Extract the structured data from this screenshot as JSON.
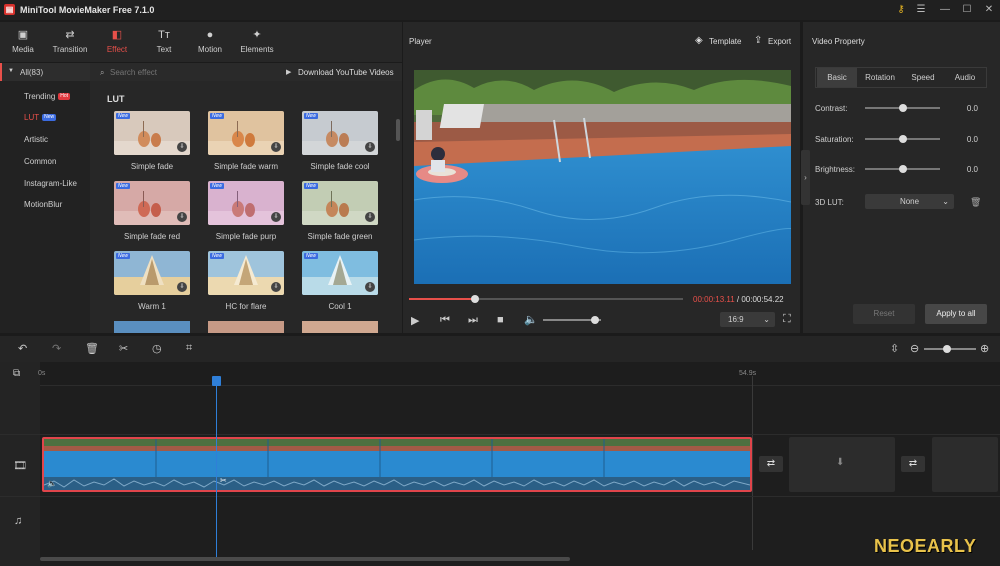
{
  "app": {
    "title": "MiniTool MovieMaker Free 7.1.0"
  },
  "toolbar": [
    {
      "label": "Media",
      "icon": "media-icon",
      "glyph": "▣"
    },
    {
      "label": "Transition",
      "icon": "transition-icon",
      "glyph": "⇄"
    },
    {
      "label": "Effect",
      "icon": "effect-icon",
      "glyph": "◧"
    },
    {
      "label": "Text",
      "icon": "text-icon",
      "glyph": "Tт"
    },
    {
      "label": "Motion",
      "icon": "motion-icon",
      "glyph": "●"
    },
    {
      "label": "Elements",
      "icon": "elements-icon",
      "glyph": "✦"
    }
  ],
  "active_tool": "Effect",
  "sidebar": {
    "all_label": "All(83)",
    "items": [
      {
        "label": "Trending",
        "badge": "Hot",
        "badge_color": "#e0383e"
      },
      {
        "label": "LUT",
        "badge": "New",
        "badge_color": "#3b6be0",
        "active": true
      },
      {
        "label": "Artistic",
        "badge": ""
      },
      {
        "label": "Common",
        "badge": ""
      },
      {
        "label": "Instagram-Like",
        "badge": ""
      },
      {
        "label": "MotionBlur",
        "badge": ""
      }
    ]
  },
  "effects": {
    "search_placeholder": "Search effect",
    "download_link": "Download YouTube Videos",
    "section_title": "LUT",
    "new_badge": "New",
    "items": [
      {
        "label": "Simple fade",
        "tint": "#d8c9bc"
      },
      {
        "label": "Simple fade warm",
        "tint": "#e0c39f"
      },
      {
        "label": "Simple fade cool",
        "tint": "#c6cbd0"
      },
      {
        "label": "Simple fade red",
        "tint": "#d6a9a6"
      },
      {
        "label": "Simple fade purp",
        "tint": "#d9b2cf"
      },
      {
        "label": "Simple fade green",
        "tint": "#c2cdb4"
      },
      {
        "label": "Warm 1",
        "tint": "#e6cf9d"
      },
      {
        "label": "HC for flare",
        "tint": "#ecd9b0"
      },
      {
        "label": "Cool 1",
        "tint": "#b9dbe8"
      }
    ]
  },
  "player": {
    "title": "Player",
    "template_label": "Template",
    "export_label": "Export",
    "current_time": "00:00:13.11",
    "total_time": "/ 00:00:54.22",
    "progress": 0.24,
    "volume": 0.9,
    "aspect": "16:9"
  },
  "video_property": {
    "title": "Video Property",
    "tabs": [
      "Basic",
      "Rotation",
      "Speed",
      "Audio"
    ],
    "active_tab": "Basic",
    "props": [
      {
        "label": "Contrast:",
        "value": "0.0",
        "level": 0.5
      },
      {
        "label": "Saturation:",
        "value": "0.0",
        "level": 0.5
      },
      {
        "label": "Brightness:",
        "value": "0.0",
        "level": 0.5
      }
    ],
    "lut_label": "3D LUT:",
    "lut_value": "None",
    "reset_label": "Reset",
    "apply_label": "Apply to all"
  },
  "timeline": {
    "start_label": "0s",
    "end_label": "54.9s",
    "zoom_level": 0.45
  },
  "watermark": "NEOEARLY",
  "colors": {
    "accent": "#e8504a",
    "playhead": "#2f7fd8",
    "clip_border": "#e0454b"
  }
}
